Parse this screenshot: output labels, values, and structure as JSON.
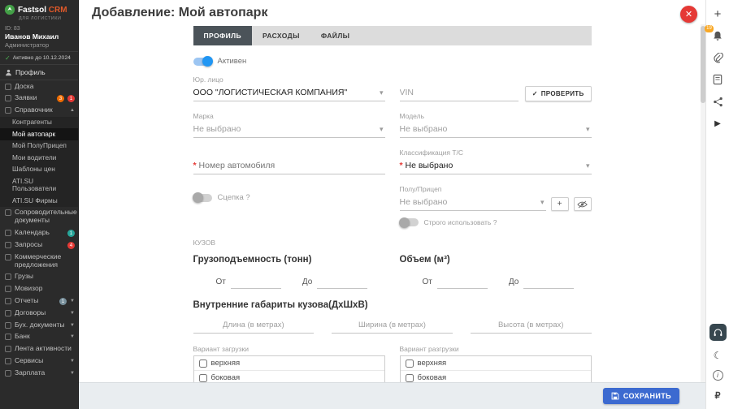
{
  "brand": {
    "primary": "Fastsol",
    "secondary": "CRM",
    "tagline": "ДЛЯ ЛОГИСТИКИ"
  },
  "user": {
    "id": "ID: 83",
    "name": "Иванов Михаил",
    "role": "Администратор",
    "active_until": "Активно до 10.12.2024",
    "profile": "Профиль"
  },
  "sidebar": {
    "items": [
      {
        "label": "Доска"
      },
      {
        "label": "Заявки",
        "badges": [
          "3",
          "1"
        ]
      },
      {
        "label": "Справочник"
      },
      {
        "label": "Контрагенты"
      },
      {
        "label": "Мой автопарк"
      },
      {
        "label": "Мой ПолуПрицеп"
      },
      {
        "label": "Мои водители"
      },
      {
        "label": "Шаблоны цен"
      },
      {
        "label": "ATI.SU Пользователи"
      },
      {
        "label": "ATI.SU Фирмы"
      },
      {
        "label": "Сопроводительные документы"
      },
      {
        "label": "Календарь",
        "badge": "1"
      },
      {
        "label": "Запросы",
        "badge": "4"
      },
      {
        "label": "Коммерческие предложения"
      },
      {
        "label": "Грузы"
      },
      {
        "label": "Мовизор"
      },
      {
        "label": "Отчеты",
        "badge": "1"
      },
      {
        "label": "Договоры"
      },
      {
        "label": "Бух. документы"
      },
      {
        "label": "Банк"
      },
      {
        "label": "Лента активности"
      },
      {
        "label": "Сервисы"
      },
      {
        "label": "Зарплата"
      }
    ]
  },
  "header": {
    "title": "Добавление: Мой автопарк"
  },
  "tabs": {
    "profile": "ПРОФИЛЬ",
    "expenses": "РАСХОДЫ",
    "files": "ФАЙЛЫ"
  },
  "form": {
    "active_label": "Активен",
    "legal_entity": {
      "label": "Юр. лицо",
      "value": "ООО \"ЛОГИСТИЧЕСКАЯ КОМПАНИЯ\""
    },
    "vin": {
      "placeholder": "VIN",
      "check_button": "ПРОВЕРИТЬ"
    },
    "brand": {
      "label": "Марка",
      "value": "Не выбрано"
    },
    "model": {
      "label": "Модель",
      "value": "Не выбрано"
    },
    "car_number": {
      "label": "Номер автомобиля"
    },
    "classification": {
      "label": "Классификация Т/С",
      "value": "Не выбрано"
    },
    "coupling": {
      "label": "Сцепка ?"
    },
    "trailer": {
      "label": "Полу/Прицеп",
      "value": "Не выбрано"
    },
    "strict_use": {
      "label": "Строго использовать ?"
    },
    "body_section": "КУЗОВ",
    "capacity": {
      "title": "Грузоподъемность (тонн)",
      "from": "От",
      "to": "До"
    },
    "volume": {
      "title": "Объем (м³)",
      "from": "От",
      "to": "До"
    },
    "dimensions": {
      "title": "Внутренние габариты кузова(ДхШхВ)",
      "length_ph": "Длина (в метрах)",
      "width_ph": "Ширина (в метрах)",
      "height_ph": "Высота (в метрах)"
    },
    "loading": {
      "label": "Вариант загрузки",
      "options": [
        "верхняя",
        "боковая"
      ]
    },
    "unloading": {
      "label": "Вариант разгрузки",
      "options": [
        "верхняя",
        "боковая"
      ]
    },
    "save_button": "СОХРАНИТЬ"
  },
  "rail": {
    "bell_badge": "19"
  },
  "icons": {
    "close": "✕",
    "check": "✓",
    "plus": "+",
    "play": "▶",
    "moon": "☾",
    "info": "i",
    "ruble": "₽"
  },
  "colors": {
    "accent_blue": "#3c6ad0",
    "danger_red": "#e53935",
    "toggle_on": "#2196f3",
    "tab_active": "#4b5359"
  }
}
